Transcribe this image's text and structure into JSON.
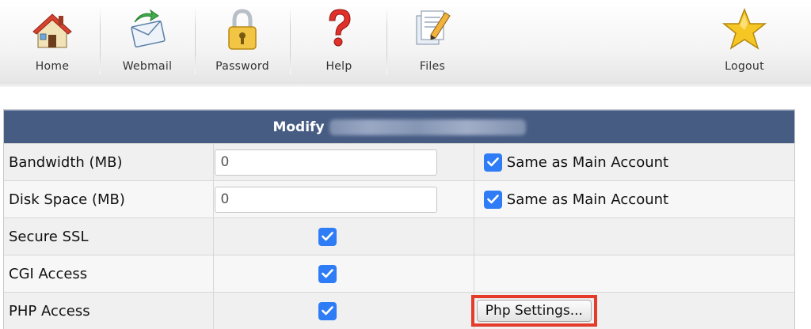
{
  "toolbar": {
    "items": [
      {
        "label": "Home"
      },
      {
        "label": "Webmail"
      },
      {
        "label": "Password"
      },
      {
        "label": "Help"
      },
      {
        "label": "Files"
      }
    ],
    "logout": "Logout"
  },
  "panel": {
    "title": "Modify"
  },
  "rows": [
    {
      "label": "Bandwidth (MB)",
      "value": "0",
      "checked": true,
      "option": "Same as Main Account"
    },
    {
      "label": "Disk Space (MB)",
      "value": "0",
      "checked": true,
      "option": "Same as Main Account"
    },
    {
      "label": "Secure SSL",
      "checked": true
    },
    {
      "label": "CGI Access",
      "checked": true
    },
    {
      "label": "PHP Access",
      "checked": true,
      "button": "Php Settings..."
    }
  ],
  "colors": {
    "header": "#475c83",
    "checkbox": "#2f7df6",
    "highlight": "#e43b2a"
  }
}
